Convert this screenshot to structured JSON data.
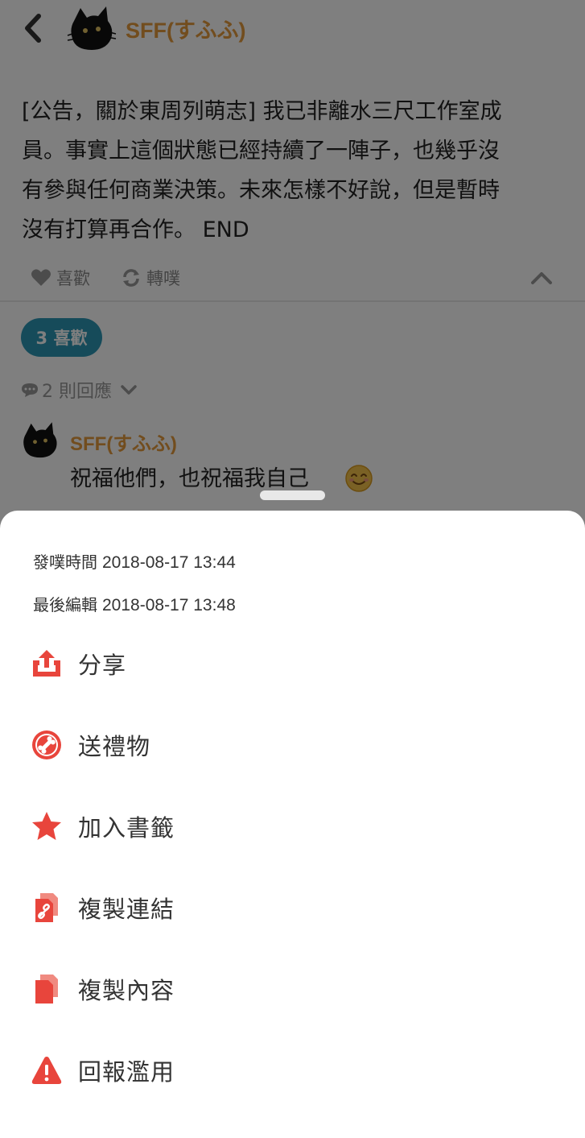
{
  "post": {
    "author": "SFF(すふふ)",
    "content": "[公告，關於東周列萌志] 我已非離水三尺工作室成\n員。事實上這個狀態已經持續了一陣子，也幾乎沒\n有參與任何商業決策。未來怎樣不好說，但是暫時\n沒有打算再合作。 END",
    "like_label": "喜歡",
    "replurk_label": "轉噗",
    "likes_count": "3 喜歡",
    "replies_count": "2 則回應"
  },
  "reply": {
    "author": "SFF(すふふ)",
    "text": "祝福他們，也祝福我自己"
  },
  "sheet": {
    "posted_label": "發噗時間",
    "posted_time": "2018-08-17 13:44",
    "edited_label": "最後編輯",
    "edited_time": "2018-08-17 13:48",
    "items": [
      {
        "label": "分享",
        "icon": "share-icon"
      },
      {
        "label": "送禮物",
        "icon": "gift-icon"
      },
      {
        "label": "加入書籤",
        "icon": "star-icon"
      },
      {
        "label": "複製連結",
        "icon": "copy-link-icon"
      },
      {
        "label": "複製內容",
        "icon": "copy-content-icon"
      },
      {
        "label": "回報濫用",
        "icon": "warning-icon"
      }
    ]
  },
  "colors": {
    "accent": "#e8453c",
    "author": "#e59a3d",
    "likes_pill": "#2d97b5"
  }
}
